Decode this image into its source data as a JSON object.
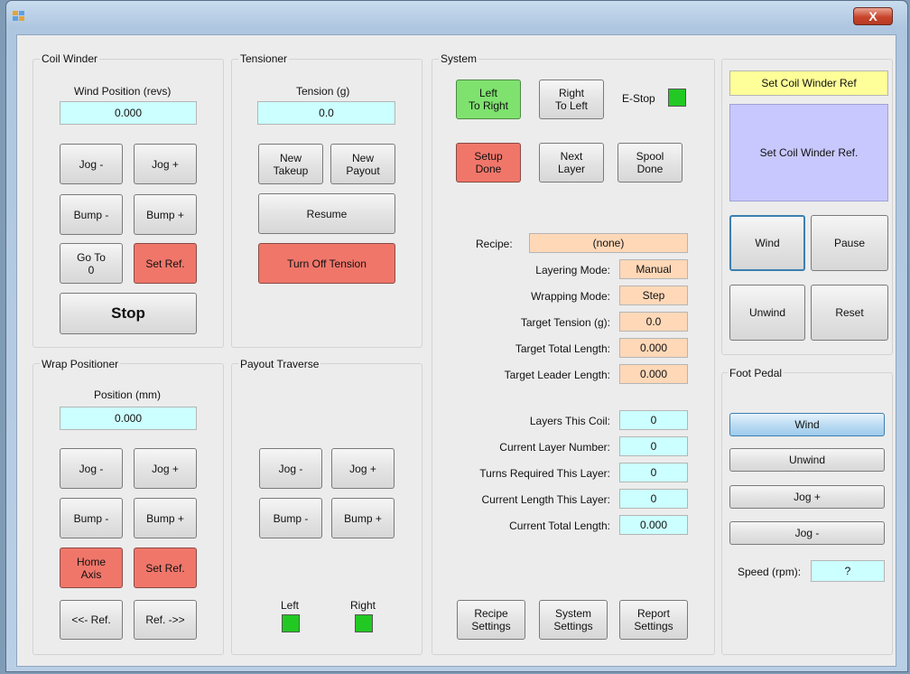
{
  "title_bar": {
    "close_label": "X"
  },
  "coil_winder": {
    "title": "Coil Winder",
    "position_label": "Wind Position (revs)",
    "position_value": "0.000",
    "jog_minus": "Jog -",
    "jog_plus": "Jog +",
    "bump_minus": "Bump -",
    "bump_plus": "Bump +",
    "go_to_zero": "Go To\n0",
    "set_ref": "Set Ref.",
    "stop": "Stop"
  },
  "tensioner": {
    "title": "Tensioner",
    "tension_label": "Tension (g)",
    "tension_value": "0.0",
    "new_takeup": "New\nTakeup",
    "new_payout": "New\nPayout",
    "resume": "Resume",
    "turn_off": "Turn Off Tension"
  },
  "wrap_positioner": {
    "title": "Wrap Positioner",
    "position_label": "Position (mm)",
    "position_value": "0.000",
    "jog_minus": "Jog -",
    "jog_plus": "Jog +",
    "bump_minus": "Bump -",
    "bump_plus": "Bump +",
    "home_axis": "Home\nAxis",
    "set_ref": "Set Ref.",
    "ref_left": "<<- Ref.",
    "ref_right": "Ref. ->>"
  },
  "payout_traverse": {
    "title": "Payout Traverse",
    "jog_minus": "Jog -",
    "jog_plus": "Jog +",
    "bump_minus": "Bump -",
    "bump_plus": "Bump +",
    "left_label": "Left",
    "right_label": "Right"
  },
  "system": {
    "title": "System",
    "left_to_right": "Left\nTo Right",
    "right_to_left": "Right\nTo Left",
    "estop_label": "E-Stop",
    "setup_done": "Setup\nDone",
    "next_layer": "Next\nLayer",
    "spool_done": "Spool\nDone",
    "recipe_label": "Recipe:",
    "recipe_value": "(none)",
    "layering_mode_label": "Layering Mode:",
    "layering_mode_value": "Manual",
    "wrapping_mode_label": "Wrapping Mode:",
    "wrapping_mode_value": "Step",
    "target_tension_label": "Target Tension (g):",
    "target_tension_value": "0.0",
    "target_total_length_label": "Target Total Length:",
    "target_total_length_value": "0.000",
    "target_leader_length_label": "Target Leader Length:",
    "target_leader_length_value": "0.000",
    "layers_this_coil_label": "Layers This Coil:",
    "layers_this_coil_value": "0",
    "current_layer_number_label": "Current Layer Number:",
    "current_layer_number_value": "0",
    "turns_required_label": "Turns Required This Layer:",
    "turns_required_value": "0",
    "current_length_layer_label": "Current Length This Layer:",
    "current_length_layer_value": "0",
    "current_total_length_label": "Current Total Length:",
    "current_total_length_value": "0.000",
    "recipe_settings": "Recipe\nSettings",
    "system_settings": "System\nSettings",
    "report_settings": "Report\nSettings"
  },
  "control_panel": {
    "status_banner": "Set Coil Winder Ref",
    "status_message": "Set Coil Winder Ref.",
    "wind": "Wind",
    "pause": "Pause",
    "unwind": "Unwind",
    "reset": "Reset"
  },
  "foot_pedal": {
    "title": "Foot Pedal",
    "wind": "Wind",
    "unwind": "Unwind",
    "jog_plus": "Jog +",
    "jog_minus": "Jog -",
    "speed_label": "Speed (rpm):",
    "speed_value": "?"
  },
  "colors": {
    "accent_red": "#f0766a",
    "accent_green": "#7fe26f",
    "readout_cyan": "#ccffff",
    "readout_peach": "#ffd8b8",
    "banner_yellow": "#ffff99",
    "message_lavender": "#c8c8ff"
  }
}
